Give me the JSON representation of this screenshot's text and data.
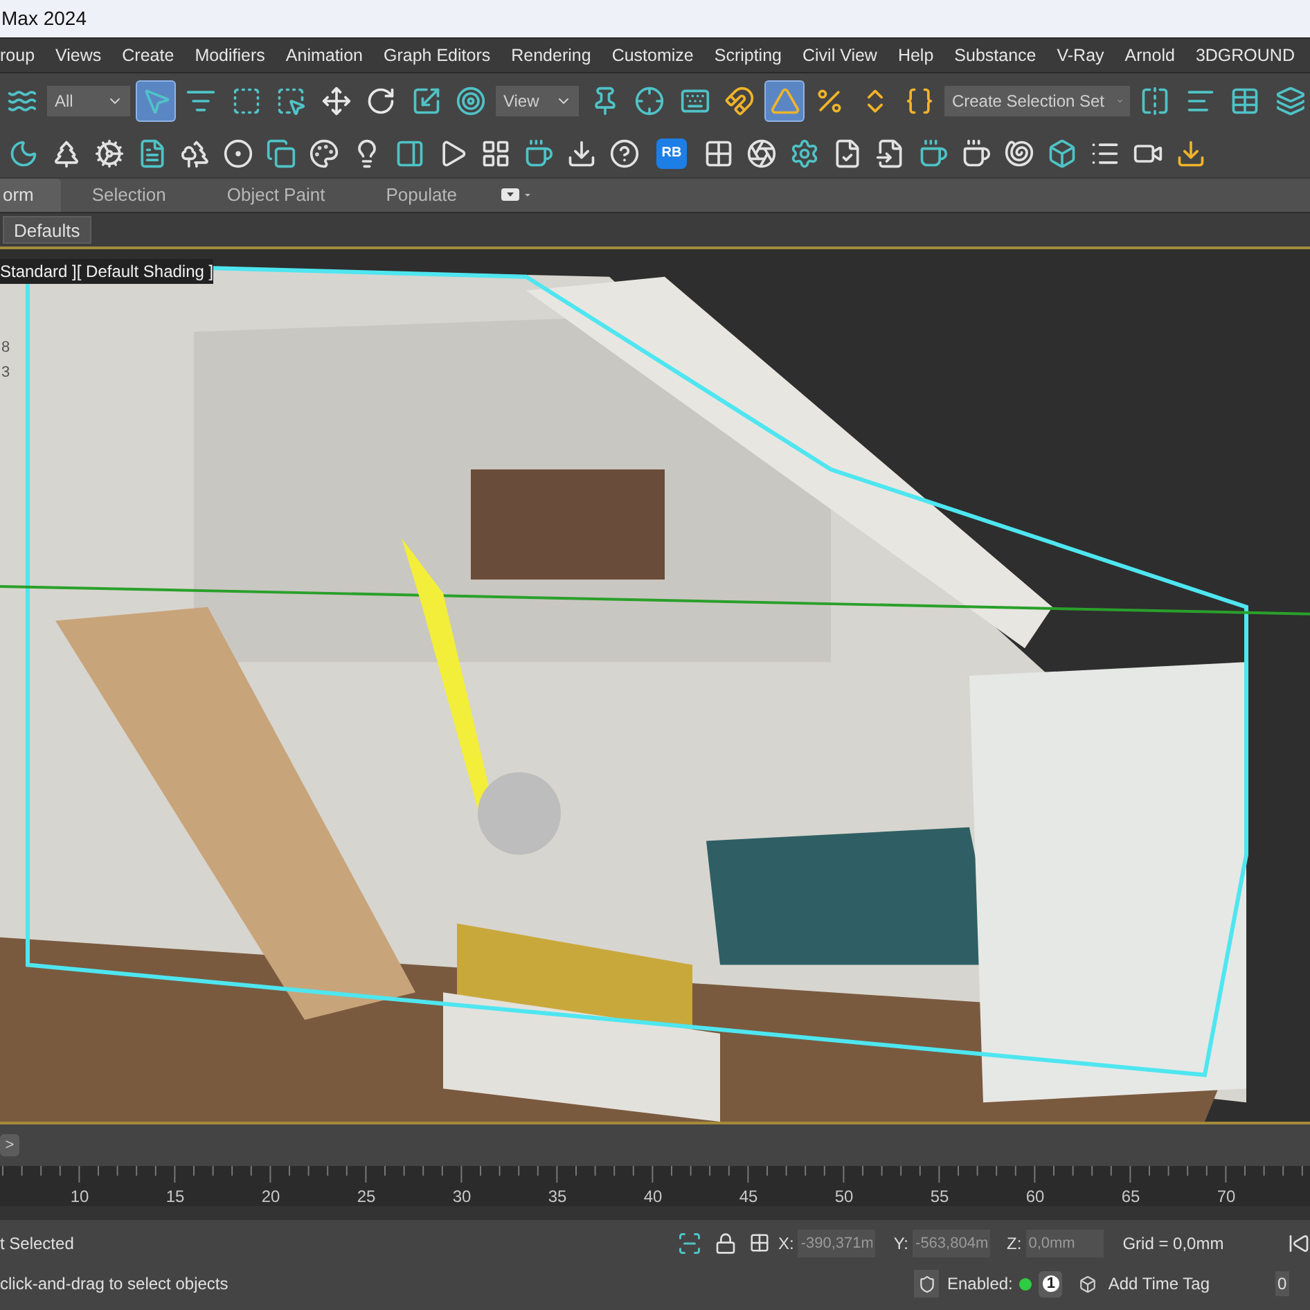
{
  "window": {
    "title": "Max 2024"
  },
  "menu": [
    "roup",
    "Views",
    "Create",
    "Modifiers",
    "Animation",
    "Graph Editors",
    "Rendering",
    "Customize",
    "Scripting",
    "Civil View",
    "Help",
    "Substance",
    "V-Ray",
    "Arnold",
    "3DGROUND"
  ],
  "toolbar_main": [
    {
      "kind": "tool",
      "selected": false
    },
    {
      "kind": "dropdown",
      "value": "All"
    },
    {
      "kind": "tool",
      "selected": true
    },
    {
      "kind": "tool",
      "selected": false
    },
    {
      "kind": "tool",
      "selected": false
    },
    {
      "kind": "tool",
      "selected": false
    },
    {
      "kind": "tool",
      "selected": false
    },
    {
      "kind": "tool",
      "selected": false
    },
    {
      "kind": "tool",
      "selected": false
    },
    {
      "kind": "tool",
      "selected": false
    },
    {
      "kind": "dropdown",
      "value": "View"
    },
    {
      "kind": "tool",
      "selected": false
    },
    {
      "kind": "tool",
      "selected": false
    },
    {
      "kind": "tool",
      "selected": false
    },
    {
      "kind": "tool",
      "selected": false
    },
    {
      "kind": "tool",
      "selected": true
    },
    {
      "kind": "tool",
      "selected": false
    },
    {
      "kind": "tool",
      "selected": false
    },
    {
      "kind": "tool",
      "selected": false
    },
    {
      "kind": "dropdown",
      "value": "Create Selection Set"
    },
    {
      "kind": "tool",
      "selected": false
    },
    {
      "kind": "tool",
      "selected": false
    },
    {
      "kind": "tool",
      "selected": false
    },
    {
      "kind": "tool",
      "selected": false
    }
  ],
  "toolbar_secondary": [
    {
      "kind": "tool"
    },
    {
      "kind": "tool"
    },
    {
      "kind": "tool"
    },
    {
      "kind": "tool"
    },
    {
      "kind": "tool"
    },
    {
      "kind": "tool"
    },
    {
      "kind": "tool"
    },
    {
      "kind": "tool"
    },
    {
      "kind": "tool"
    },
    {
      "kind": "tool"
    },
    {
      "kind": "tool"
    },
    {
      "kind": "tool"
    },
    {
      "kind": "tool"
    },
    {
      "kind": "tool"
    },
    {
      "kind": "tool"
    },
    {
      "kind": "badge",
      "label": "RB"
    },
    {
      "kind": "tool"
    },
    {
      "kind": "tool"
    },
    {
      "kind": "tool"
    },
    {
      "kind": "tool"
    },
    {
      "kind": "tool"
    },
    {
      "kind": "tool"
    },
    {
      "kind": "tool"
    },
    {
      "kind": "tool"
    },
    {
      "kind": "tool"
    },
    {
      "kind": "tool"
    },
    {
      "kind": "tool"
    },
    {
      "kind": "tool"
    }
  ],
  "ribbon_tabs": [
    {
      "label": "orm",
      "selected": true
    },
    {
      "label": "Selection",
      "selected": false
    },
    {
      "label": "Object Paint",
      "selected": false
    },
    {
      "label": "Populate",
      "selected": false
    }
  ],
  "ribbon_panel": {
    "label": "Defaults"
  },
  "viewport": {
    "label": "Standard ][ Default Shading ]",
    "stats": [
      "8",
      "3"
    ]
  },
  "timeline": {
    "next_button": ">",
    "ticks": [
      "10",
      "15",
      "20",
      "25",
      "30",
      "35",
      "40",
      "45",
      "50",
      "55",
      "60",
      "65",
      "70"
    ]
  },
  "status_bar": {
    "selection": "t Selected",
    "prompt": "click-and-drag to select objects",
    "x_label": "X:",
    "x_value": "-390,371m",
    "y_label": "Y:",
    "y_value": "-563,804m",
    "z_label": "Z:",
    "z_value": "0,0mm",
    "grid": "Grid = 0,0mm",
    "enabled_label": "Enabled:",
    "enabled": true,
    "count": "1",
    "time_tag": "Add Time Tag",
    "frame": "0"
  }
}
